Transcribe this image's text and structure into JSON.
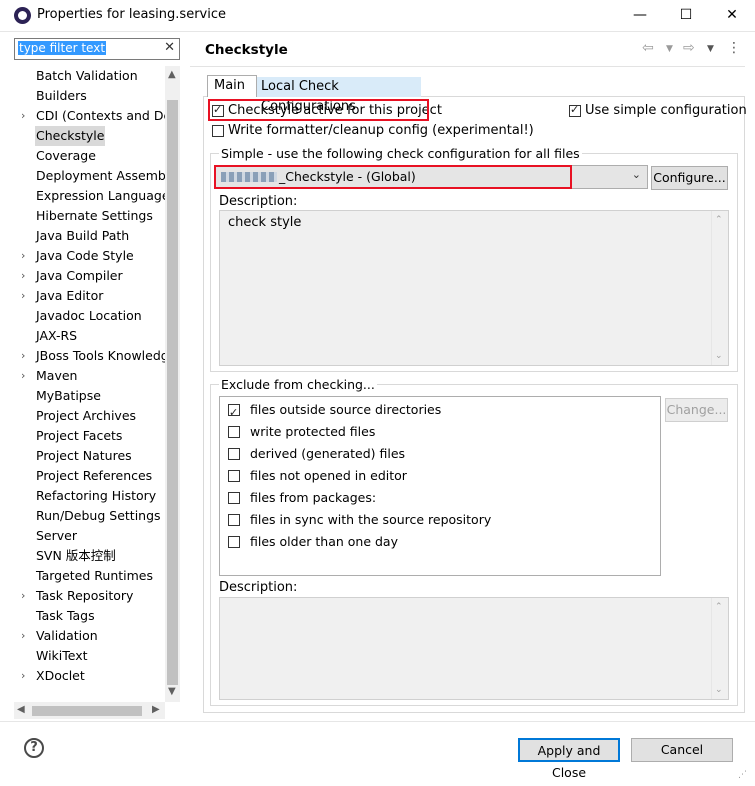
{
  "window": {
    "title": "Properties for leasing.service",
    "minimize": "—",
    "maximize": "☐",
    "close": "✕"
  },
  "sidebar": {
    "filter_placeholder": "type filter text",
    "filter_clear": "✕",
    "items": [
      {
        "label": "Batch Validation",
        "expandable": false
      },
      {
        "label": "Builders",
        "expandable": false
      },
      {
        "label": "CDI (Contexts and Dep",
        "expandable": true
      },
      {
        "label": "Checkstyle",
        "expandable": false,
        "selected": true
      },
      {
        "label": "Coverage",
        "expandable": false
      },
      {
        "label": "Deployment Assembly",
        "expandable": false
      },
      {
        "label": "Expression Language",
        "expandable": false
      },
      {
        "label": "Hibernate Settings",
        "expandable": false
      },
      {
        "label": "Java Build Path",
        "expandable": false
      },
      {
        "label": "Java Code Style",
        "expandable": true
      },
      {
        "label": "Java Compiler",
        "expandable": true
      },
      {
        "label": "Java Editor",
        "expandable": true
      },
      {
        "label": "Javadoc Location",
        "expandable": false
      },
      {
        "label": "JAX-RS",
        "expandable": false
      },
      {
        "label": "JBoss Tools Knowledg",
        "expandable": true
      },
      {
        "label": "Maven",
        "expandable": true
      },
      {
        "label": "MyBatipse",
        "expandable": false
      },
      {
        "label": "Project Archives",
        "expandable": false
      },
      {
        "label": "Project Facets",
        "expandable": false
      },
      {
        "label": "Project Natures",
        "expandable": false
      },
      {
        "label": "Project References",
        "expandable": false
      },
      {
        "label": "Refactoring History",
        "expandable": false
      },
      {
        "label": "Run/Debug Settings",
        "expandable": false
      },
      {
        "label": "Server",
        "expandable": false
      },
      {
        "label": "SVN 版本控制",
        "expandable": false
      },
      {
        "label": "Targeted Runtimes",
        "expandable": false
      },
      {
        "label": "Task Repository",
        "expandable": true
      },
      {
        "label": "Task Tags",
        "expandable": false
      },
      {
        "label": "Validation",
        "expandable": true
      },
      {
        "label": "WikiText",
        "expandable": false
      },
      {
        "label": "XDoclet",
        "expandable": true
      }
    ]
  },
  "page": {
    "title": "Checkstyle",
    "tabs": [
      {
        "label": "Main",
        "active": true
      },
      {
        "label": "Local Check Configurations",
        "active": false
      }
    ],
    "checkstyle_active": {
      "label": "Checkstyle active for this project",
      "checked": true
    },
    "use_simple": {
      "label": "Use simple configuration",
      "checked": true
    },
    "write_formatter": {
      "label": "Write formatter/cleanup config (experimental!)",
      "checked": false
    },
    "simple_group_label": "Simple - use the following check configuration for all files",
    "config_combo_value": "_Checkstyle  - (Global)",
    "configure_button": "Configure...",
    "description_label": "Description:",
    "description_text": "check style",
    "exclude_group_label": "Exclude from checking...",
    "exclude_items": [
      {
        "label": "files outside source directories",
        "checked": true
      },
      {
        "label": "write protected files",
        "checked": false
      },
      {
        "label": "derived (generated) files",
        "checked": false
      },
      {
        "label": "files not opened in editor",
        "checked": false
      },
      {
        "label": "files from packages:",
        "checked": false
      },
      {
        "label": "files in sync with the source repository",
        "checked": false
      },
      {
        "label": "files older than one day",
        "checked": false
      }
    ],
    "change_button": "Change...",
    "exclude_description_label": "Description:"
  },
  "footer": {
    "help": "?",
    "apply_close": "Apply and Close",
    "cancel": "Cancel"
  },
  "colors": {
    "highlight_red": "#e81123",
    "selection_blue": "#3399ff",
    "default_button_border": "#0078d7",
    "tab_inactive_bg": "#d9ebf9"
  }
}
